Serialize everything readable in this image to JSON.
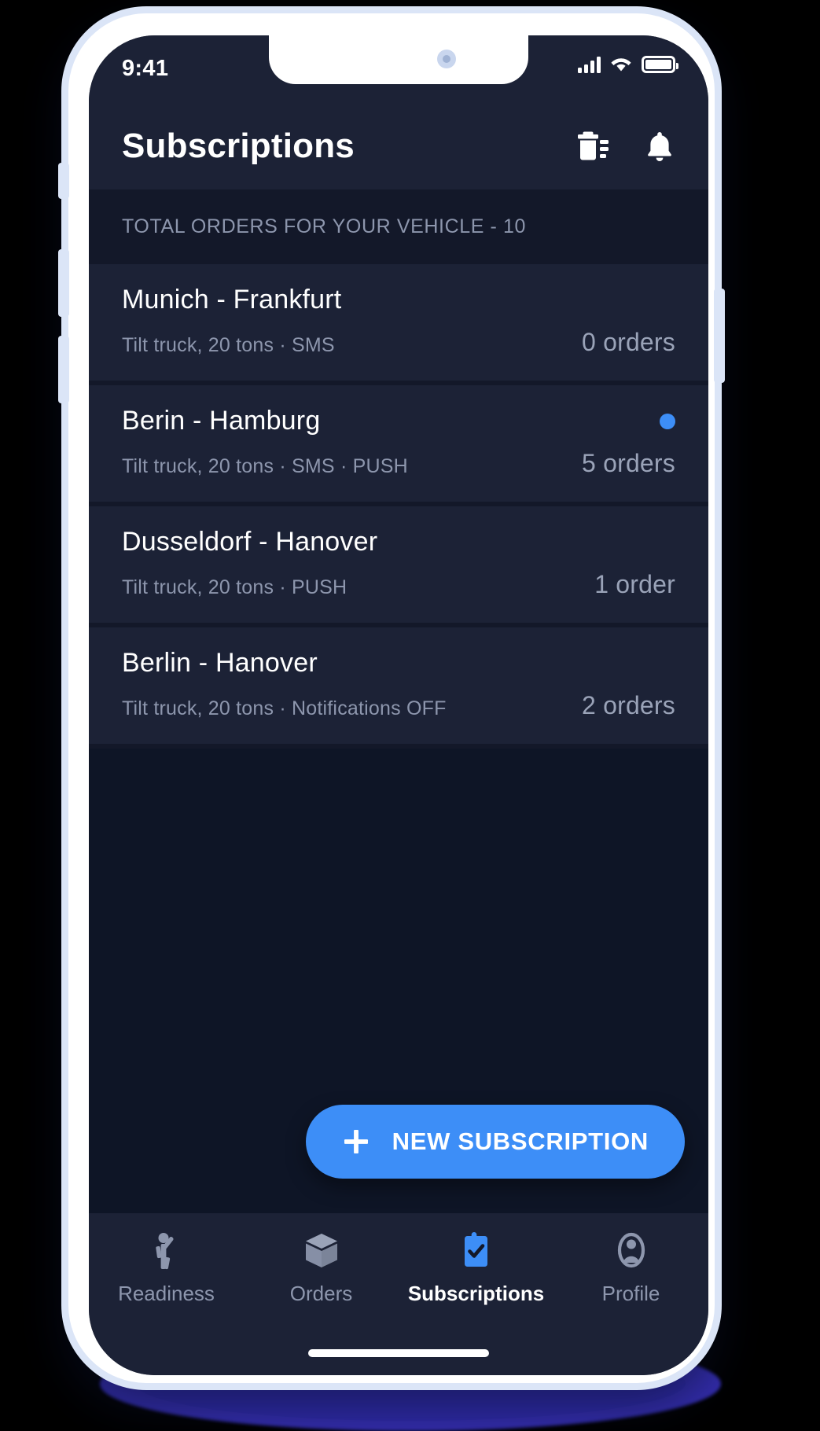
{
  "status_bar": {
    "time": "9:41",
    "icons": [
      "signal-bars-icon",
      "wifi-icon",
      "battery-icon"
    ]
  },
  "app_bar": {
    "title": "Subscriptions",
    "actions": [
      {
        "name": "delete-list-icon",
        "label": "Delete"
      },
      {
        "name": "notifications-bell-icon",
        "label": "Notifications"
      }
    ]
  },
  "section": {
    "header": "TOTAL ORDERS FOR YOUR VEHICLE - 10"
  },
  "subscriptions": [
    {
      "route": "Munich - Frankfurt",
      "details": "Tilt truck, 20 tons  ·  SMS",
      "orders": "0 orders",
      "unread": false
    },
    {
      "route": "Berin - Hamburg",
      "details": "Tilt truck, 20 tons  ·  SMS  ·  PUSH",
      "orders": "5 orders",
      "unread": true
    },
    {
      "route": "Dusseldorf - Hanover",
      "details": "Tilt truck, 20 tons  ·  PUSH",
      "orders": "1 order",
      "unread": false
    },
    {
      "route": "Berlin - Hanover",
      "details": "Tilt truck, 20 tons  ·  Notifications OFF",
      "orders": "2 orders",
      "unread": false
    }
  ],
  "fab": {
    "label": "NEW SUBSCRIPTION",
    "icon": "plus-icon"
  },
  "tab_bar": {
    "active": "Subscriptions",
    "tabs": [
      {
        "label": "Readiness",
        "icon": "person-waving-icon",
        "active": false
      },
      {
        "label": "Orders",
        "icon": "box-package-icon",
        "active": false
      },
      {
        "label": "Subscriptions",
        "icon": "clipboard-check-icon",
        "active": true
      },
      {
        "label": "Profile",
        "icon": "person-account-icon",
        "active": false
      }
    ]
  },
  "colors": {
    "accent": "#3d8ef7",
    "screen_bg": "#0e1526",
    "surface": "#1c2236",
    "section_bg": "#131829",
    "text_primary": "#ffffff",
    "text_secondary": "#8d96ad",
    "bezel": "#dbe5f7",
    "ground_shadow": "#3730b8"
  }
}
